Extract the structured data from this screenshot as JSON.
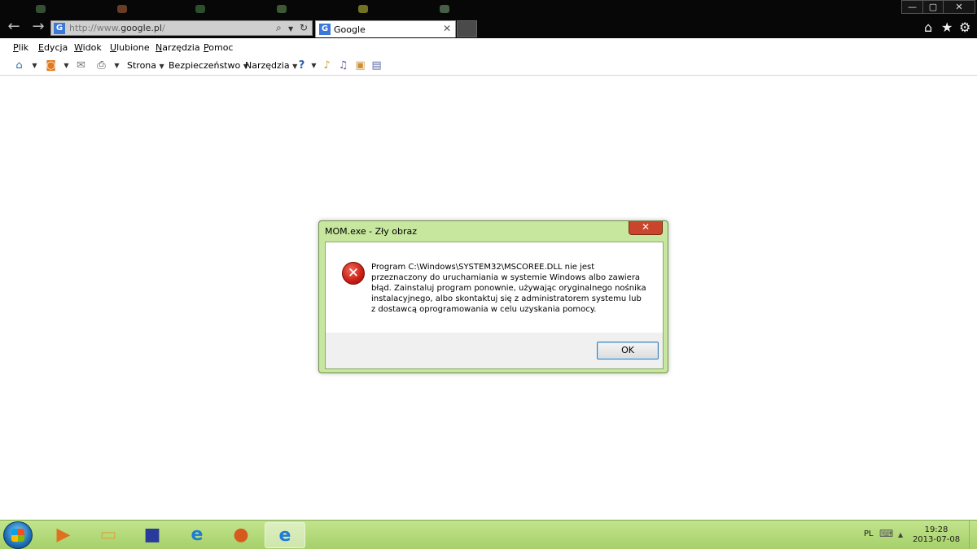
{
  "browser": {
    "address": {
      "scheme": "http://www.",
      "host": "google.pl",
      "path": "/",
      "favicon": "G"
    },
    "tab": {
      "title": "Google",
      "favicon": "G",
      "close": "✕"
    },
    "window_controls": {
      "minimize": "—",
      "maximize": "▢",
      "close": "✕"
    },
    "right_icons": {
      "home": "⌂",
      "favorites": "★",
      "tools": "⚙"
    }
  },
  "menu": {
    "items": [
      "Plik",
      "Edycja",
      "Widok",
      "Ulubione",
      "Narzędzia",
      "Pomoc"
    ]
  },
  "commandbar": {
    "page_label": "Strona",
    "safety_label": "Bezpieczeństwo",
    "tools_label": "Narzędzia"
  },
  "dialog": {
    "title": "MOM.exe - Zły obraz",
    "close": "✕",
    "icon_glyph": "✕",
    "message": "Program C:\\Windows\\SYSTEM32\\MSCOREE.DLL nie jest przeznaczony do uruchamiania w systemie Windows albo zawiera błąd. Zainstaluj program ponownie, używając oryginalnego nośnika instalacyjnego, albo skontaktuj się z administratorem systemu lub z dostawcą oprogramowania w celu uzyskania pomocy.",
    "ok_label": "OK"
  },
  "taskbar": {
    "tray_language": "PL",
    "tray_keyboard": "⌨",
    "tray_arrow": "▲",
    "time": "19:28",
    "date": "2013-07-08"
  },
  "colors": {
    "dialog_frame": "#c7e69e",
    "taskbar": "#a6d06a",
    "close_red": "#c9462c",
    "error_red": "#c81d13"
  }
}
